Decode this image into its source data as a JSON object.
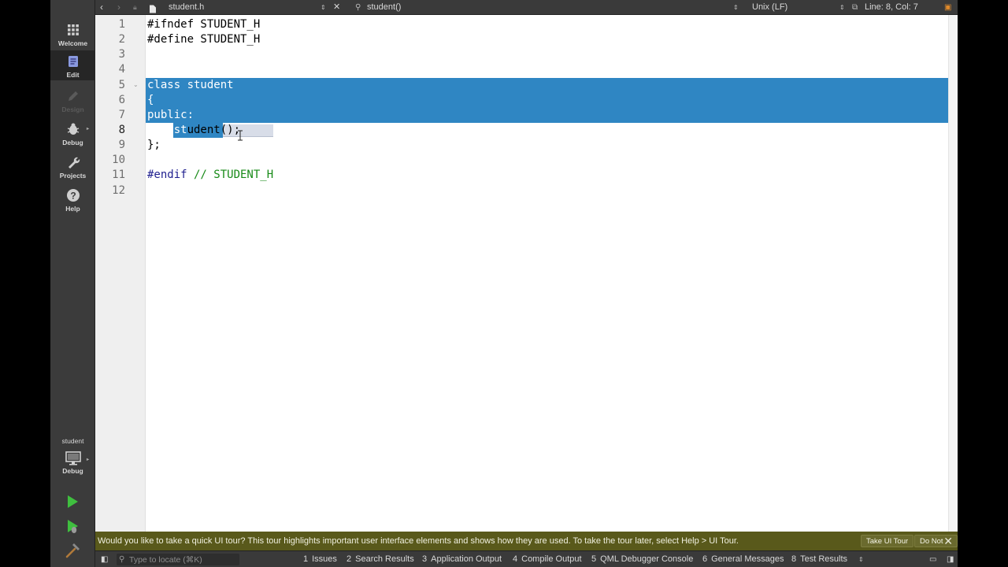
{
  "toolbar": {
    "file_name": "student.h",
    "symbol": "student()",
    "line_ending": "Unix (LF)",
    "position": "Line: 8, Col: 7"
  },
  "modes": [
    {
      "label": "Welcome",
      "icon": "grid-icon"
    },
    {
      "label": "Edit",
      "icon": "edit-document-icon"
    },
    {
      "label": "Design",
      "icon": "pencil-icon"
    },
    {
      "label": "Debug",
      "icon": "bug-icon"
    },
    {
      "label": "Projects",
      "icon": "wrench-icon"
    },
    {
      "label": "Help",
      "icon": "help-icon"
    }
  ],
  "kit": {
    "project": "student",
    "config": "Debug"
  },
  "editor": {
    "lines": [
      {
        "n": "1",
        "text": "#ifndef STUDENT_H"
      },
      {
        "n": "2",
        "text": "#define STUDENT_H"
      },
      {
        "n": "3",
        "text": ""
      },
      {
        "n": "4",
        "text": ""
      },
      {
        "n": "5",
        "text": "class student"
      },
      {
        "n": "6",
        "text": "{"
      },
      {
        "n": "7",
        "text": "public:"
      },
      {
        "n": "8",
        "text": "    student();"
      },
      {
        "n": "9",
        "text": "};"
      },
      {
        "n": "10",
        "text": ""
      },
      {
        "n": "11",
        "text": "#endif // STUDENT_H"
      },
      {
        "n": "12",
        "text": ""
      }
    ],
    "line8_prefix": "    st",
    "line8_rest": "udent();",
    "line11_directive": "#endif",
    "line11_comment": " // STUDENT_H"
  },
  "infobar": {
    "message": "Would you like to take a quick UI tour? This tour highlights important user interface elements and shows how they are used. To take the tour later, select Help > UI Tour.",
    "take_tour": "Take UI Tour",
    "dont_show": "Do Not Show Again"
  },
  "statusbar": {
    "locator_placeholder": "Type to locate (⌘K)",
    "panes": [
      {
        "num": "1",
        "label": "Issues"
      },
      {
        "num": "2",
        "label": "Search Results"
      },
      {
        "num": "3",
        "label": "Application Output"
      },
      {
        "num": "4",
        "label": "Compile Output"
      },
      {
        "num": "5",
        "label": "QML Debugger Console"
      },
      {
        "num": "6",
        "label": "General Messages"
      },
      {
        "num": "8",
        "label": "Test Results"
      }
    ]
  },
  "colors": {
    "selection": "#2f86c3",
    "infobar": "#59591b",
    "comment": "#178a17",
    "run_green": "#3fbf3f"
  }
}
